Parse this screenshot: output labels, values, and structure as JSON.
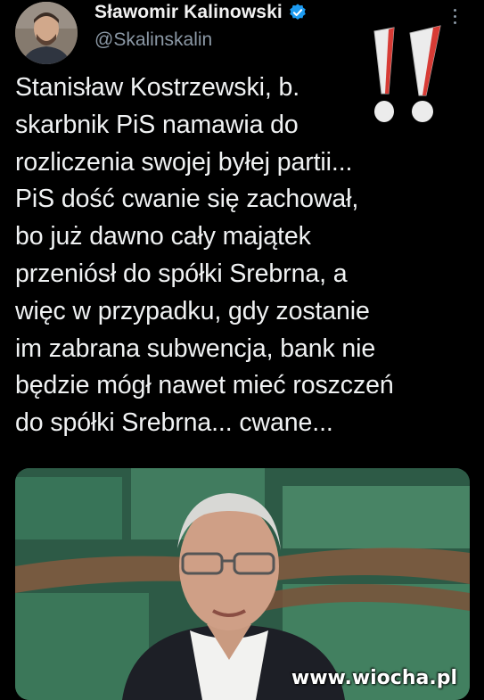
{
  "author": {
    "display_name": "Sławomir Kalinowski",
    "handle": "@Skalinskalin",
    "verified": true
  },
  "icons": {
    "verified": "verified-badge-icon",
    "more": "more-options-icon",
    "exclamation": "double-exclamation-icon"
  },
  "tweet": {
    "text": "Stanisław Kostrzewski, b.\nskarbnik PiS namawia do\nrozliczenia swojej byłej partii...\nPiS dość cwanie się zachował,\nbo już dawno cały majątek\nprzeniósł do spółki Srebrna, a\nwięc w przypadku, gdy zostanie\nim zabrana subwencja, bank nie\nbędzie mógł nawet mieć roszczeń\ndo spółki Srebrna... cwane..."
  },
  "media": {
    "watermark": "www.wiocha.pl"
  },
  "colors": {
    "background": "#000000",
    "text": "#e7e9ea",
    "secondary_text": "#8b98a5",
    "verified_blue": "#1d9bf0",
    "exclamation_red": "#e23b35"
  }
}
